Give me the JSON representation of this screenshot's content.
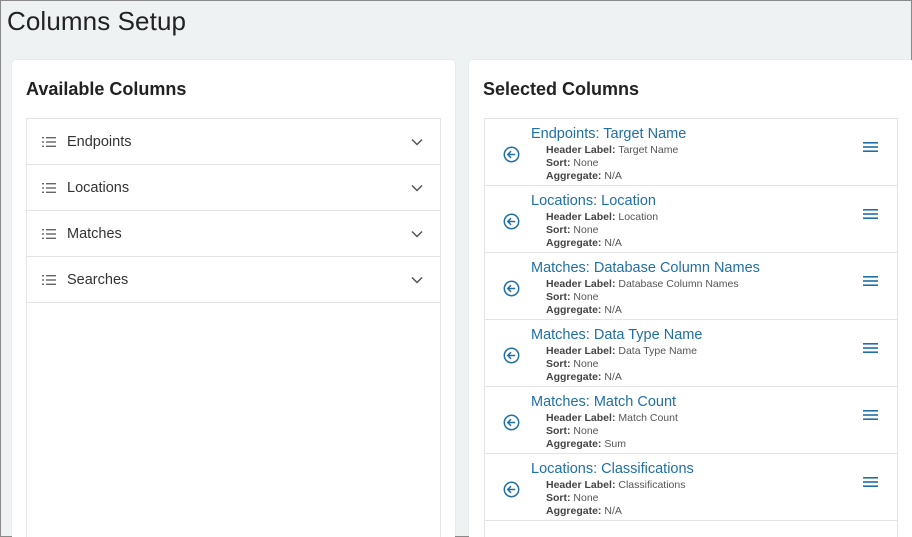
{
  "page": {
    "title": "Columns Setup"
  },
  "available": {
    "title": "Available Columns",
    "groups": [
      {
        "label": "Endpoints"
      },
      {
        "label": "Locations"
      },
      {
        "label": "Matches"
      },
      {
        "label": "Searches"
      }
    ]
  },
  "selected": {
    "title": "Selected Columns",
    "label_header": "Header Label:",
    "label_sort": "Sort:",
    "label_aggregate": "Aggregate:",
    "items": [
      {
        "title": "Endpoints: Target Name",
        "header_label": "Target Name",
        "sort": "None",
        "aggregate": "N/A"
      },
      {
        "title": "Locations: Location",
        "header_label": "Location",
        "sort": "None",
        "aggregate": "N/A"
      },
      {
        "title": "Matches: Database Column Names",
        "header_label": "Database Column Names",
        "sort": "None",
        "aggregate": "N/A"
      },
      {
        "title": "Matches: Data Type Name",
        "header_label": "Data Type Name",
        "sort": "None",
        "aggregate": "N/A"
      },
      {
        "title": "Matches: Match Count",
        "header_label": "Match Count",
        "sort": "None",
        "aggregate": "Sum"
      },
      {
        "title": "Locations: Classifications",
        "header_label": "Classifications",
        "sort": "None",
        "aggregate": "N/A"
      }
    ]
  },
  "icons": {
    "group_icon": "list-icon",
    "expand_icon": "chevron-down-icon",
    "remove_icon": "arrow-left-circle-icon",
    "drag_icon": "drag-handle-icon"
  },
  "colors": {
    "accent": "#1f6fa8",
    "background": "#eef2f3",
    "panel": "#ffffff"
  }
}
